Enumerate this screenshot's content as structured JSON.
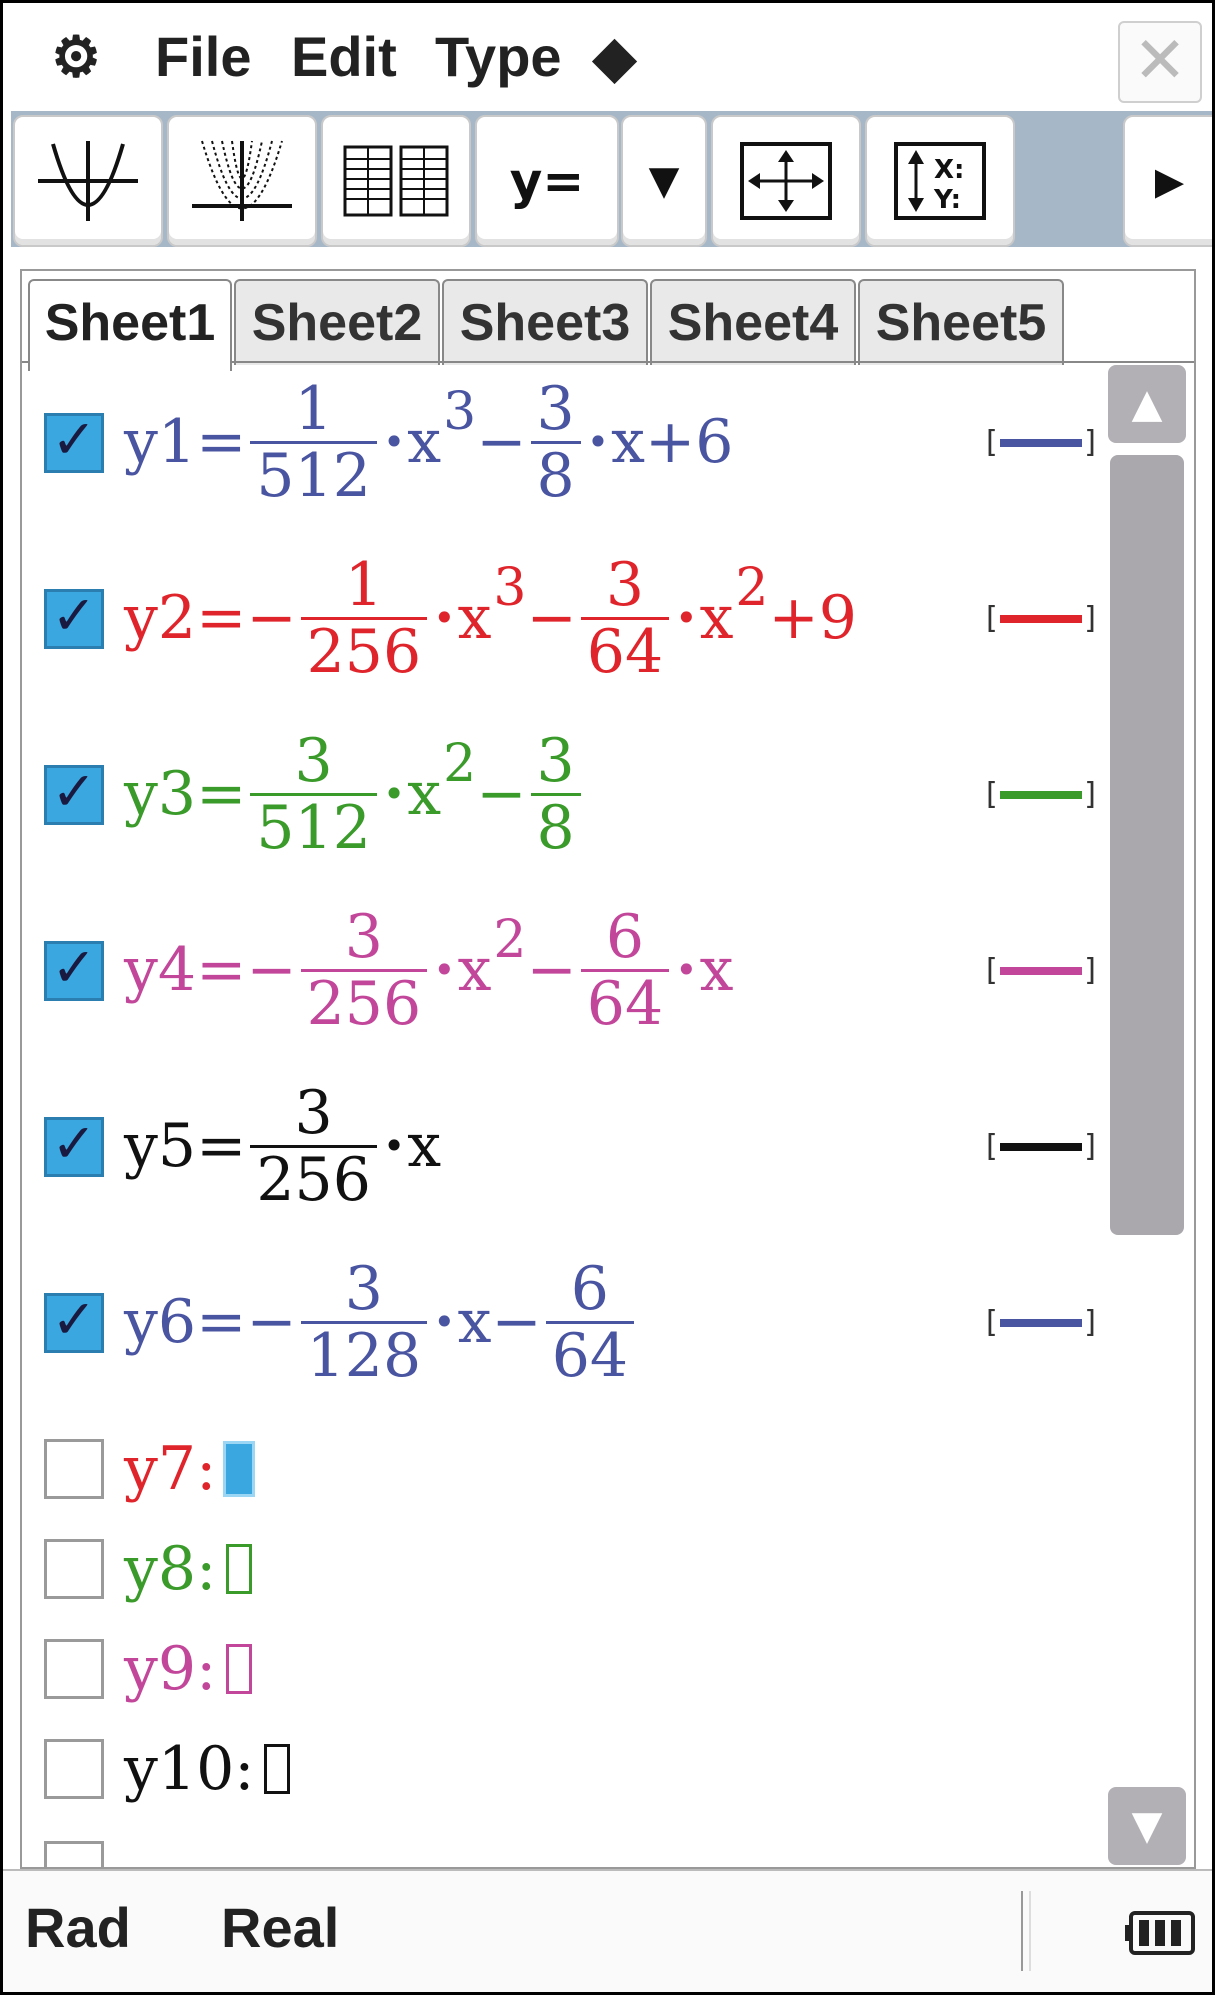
{
  "menubar": {
    "gear_icon": "⚙",
    "file": "File",
    "edit": "Edit",
    "type": "Type",
    "diamond": "◆",
    "close_icon": "✕"
  },
  "toolbar": {
    "buttons": [
      {
        "icon": "graph-icon"
      },
      {
        "icon": "multi-graph-icon"
      },
      {
        "icon": "table-icon"
      },
      {
        "label": "y="
      },
      {
        "label": "▼"
      },
      {
        "icon": "zoom-fit-icon"
      },
      {
        "icon": "view-window-icon"
      },
      {
        "label": "▶"
      }
    ]
  },
  "tabs": [
    "Sheet1",
    "Sheet2",
    "Sheet3",
    "Sheet4",
    "Sheet5"
  ],
  "active_tab": "Sheet1",
  "colors": {
    "blue": "#4a55a2",
    "red": "#e0242b",
    "green": "#3a9a2a",
    "magenta": "#c2479a",
    "black": "#111111"
  },
  "functions": [
    {
      "name": "y1",
      "checked": true,
      "color": "#4a55a2",
      "parts": [
        "y1=",
        "1",
        "512",
        "x",
        "3",
        "−",
        "3",
        "8",
        "x+6"
      ]
    },
    {
      "name": "y2",
      "checked": true,
      "color": "#e0242b",
      "parts": [
        "y2=−",
        "1",
        "256",
        "x",
        "3",
        "−",
        "3",
        "64",
        "x",
        "2",
        "+9"
      ]
    },
    {
      "name": "y3",
      "checked": true,
      "color": "#3a9a2a",
      "parts": [
        "y3=",
        "3",
        "512",
        "x",
        "2",
        "−",
        "3",
        "8"
      ]
    },
    {
      "name": "y4",
      "checked": true,
      "color": "#c2479a",
      "parts": [
        "y4=−",
        "3",
        "256",
        "x",
        "2",
        "−",
        "6",
        "64",
        "x"
      ]
    },
    {
      "name": "y5",
      "checked": true,
      "color": "#111111",
      "parts": [
        "y5=",
        "3",
        "256",
        "x"
      ]
    },
    {
      "name": "y6",
      "checked": true,
      "color": "#4a55a2",
      "parts": [
        "y6=−",
        "3",
        "128",
        "x−",
        "6",
        "64"
      ]
    },
    {
      "name": "y7",
      "checked": false,
      "color": "#e0242b",
      "label": "y7:"
    },
    {
      "name": "y8",
      "checked": false,
      "color": "#3a9a2a",
      "label": "y8:"
    },
    {
      "name": "y9",
      "checked": false,
      "color": "#c2479a",
      "label": "y9:"
    },
    {
      "name": "y10",
      "checked": false,
      "color": "#111111",
      "label": "y10:"
    }
  ],
  "status": {
    "angle": "Rad",
    "mode": "Real"
  }
}
